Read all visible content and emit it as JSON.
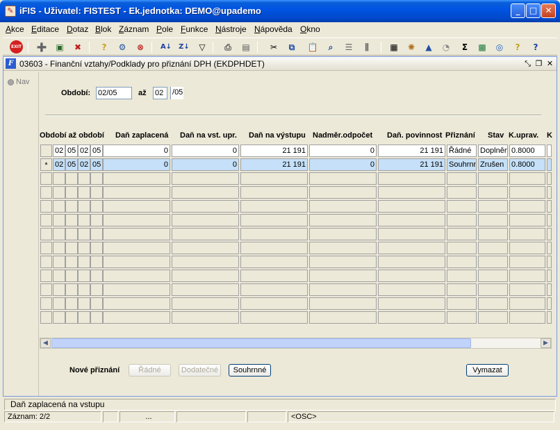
{
  "window": {
    "icon": "iFIS-app-icon",
    "title": "iFIS - Uživatel: FISTEST - Ek.jednotka: DEMO@upademo",
    "minimize": "_",
    "maximize": "□",
    "close": "✕"
  },
  "menu": [
    "Akce",
    "Editace",
    "Dotaz",
    "Blok",
    "Záznam",
    "Pole",
    "Funkce",
    "Nástroje",
    "Nápověda",
    "Okno"
  ],
  "toolbar": {
    "exit_label": "EXIT",
    "icons": [
      "exit-icon",
      "add-record-icon",
      "save-icon",
      "delete-icon",
      "query-icon",
      "execute-query-icon",
      "cancel-query-icon",
      "sort-ascending-icon",
      "sort-descending-icon",
      "filter-icon",
      "print-icon",
      "print-preview-icon",
      "cut-icon",
      "copy-icon",
      "paste-icon",
      "search-icon",
      "list-icon",
      "columns-icon",
      "calculator-icon",
      "settings-icon",
      "chart-icon",
      "clock-icon",
      "sum-icon",
      "excel-icon",
      "browser-icon",
      "help-icon",
      "whats-this-icon"
    ]
  },
  "form": {
    "title": "03603 - Finanční vztahy/Podklady pro přiznání DPH (EKDPHDET)",
    "nav_label": "Nav",
    "period_label": "Období:",
    "period_from": "02/05",
    "to_label": "až",
    "period_to_month": "02",
    "period_to_year": "05",
    "period_to_separator": "/"
  },
  "table": {
    "columns": [
      "Období až období",
      "Daň zaplacená",
      "Daň na vst. upr.",
      "Daň na výstupu",
      "Nadměr.odpočet",
      "Daň. povinnost",
      "Přiznání",
      "Stav",
      "K.uprav.",
      "K"
    ],
    "rows": [
      {
        "marker": "",
        "m1": "02",
        "y1": "05",
        "m2": "02",
        "y2": "05",
        "dan_zaplacena": "0",
        "dan_vst_upr": "0",
        "dan_vystup": "21 191",
        "nadmer": "0",
        "povinnost": "21 191",
        "priznani": "Řádné",
        "stav": "Doplněn",
        "k_uprav": "0.8000"
      },
      {
        "marker": "*",
        "m1": "02",
        "y1": "05",
        "m2": "02",
        "y2": "05",
        "dan_zaplacena": "0",
        "dan_vst_upr": "0",
        "dan_vystup": "21 191",
        "nadmer": "0",
        "povinnost": "21 191",
        "priznani": "Souhrnné",
        "stav": "Zrušen",
        "k_uprav": "0.8000"
      }
    ],
    "empty_rows": 11
  },
  "actions": {
    "new_label": "Nové přiznání",
    "radne": "Řádné",
    "dodatecne": "Dodatečné",
    "souhrnne": "Souhrnné",
    "vymazat": "Vymazat"
  },
  "status": {
    "hint": "Daň zaplacená na vstupu",
    "record": "Záznam: 2/2",
    "dots": "...",
    "mode": "<OSC>"
  }
}
